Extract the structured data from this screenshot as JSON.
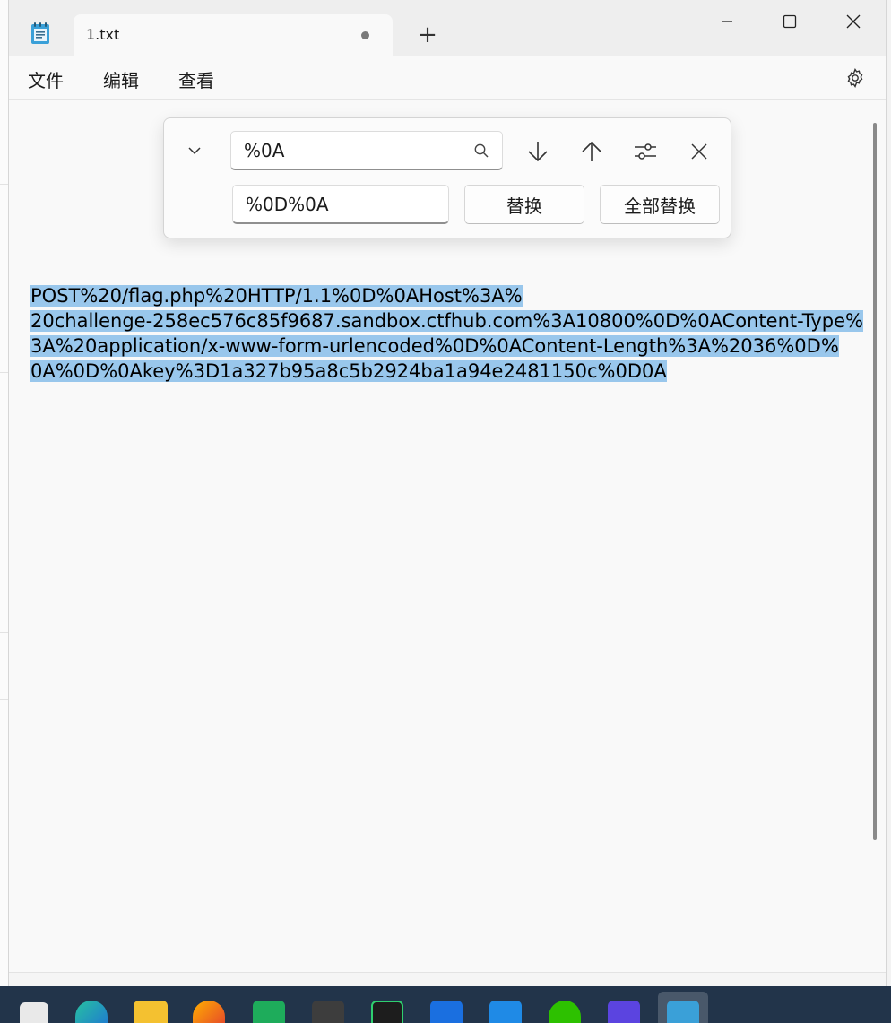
{
  "window": {
    "tab_title": "1.txt",
    "tab_new_symbol": "+"
  },
  "menu": {
    "file": "文件",
    "edit": "编辑",
    "view": "查看"
  },
  "find_replace": {
    "find_value": "%0A",
    "replace_value": "%0D%0A",
    "replace_label": "替换",
    "replace_all_label": "全部替换"
  },
  "editor": {
    "lines": [
      "POST%20/flag.php%20HTTP/1.1%0D%0AHost%3A%",
      "20challenge-258ec576c85f9687.sandbox.ctfhub.com%3A10800%0D%0AContent-Type%",
      "3A%20application/x-www-form-urlencoded%0D%0AContent-Length%3A%2036%0D%",
      "0A%0D%0Akey%3D1a327b95a8c5b2924ba1a94e2481150c%0D0A"
    ]
  },
  "colors": {
    "selection": "#99c7ec",
    "taskbar": "#22344a",
    "window_bg": "#f9f9f9",
    "titlebar": "#eeeeee"
  },
  "icons": {
    "app": "notepad-icon",
    "settings": "gear-icon",
    "find": "search-icon",
    "next": "arrow-down-icon",
    "previous": "arrow-up-icon",
    "options": "sliders-icon",
    "close_find": "close-icon",
    "expand": "chevron-down-icon"
  }
}
